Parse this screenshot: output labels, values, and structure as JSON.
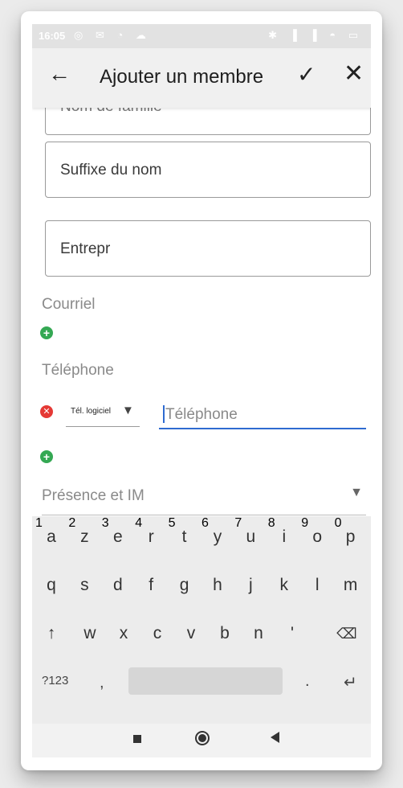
{
  "status": {
    "time": "16:05",
    "left_icons": "◎ ✉ ◔ ☁",
    "right_icons": "✱ ▐ ▐ ◓ ▭"
  },
  "appbar": {
    "back_icon": "←",
    "title": "Ajouter un membre",
    "check_icon": "✓",
    "close_icon": "✕"
  },
  "form": {
    "partial_field": "Nom de famille",
    "suffix_field": "Suffixe du nom",
    "company_field": "Entrepr",
    "email_label": "Courriel",
    "phone_label": "Téléphone",
    "phone_type": "Tél. logiciel",
    "phone_placeholder": "Téléphone",
    "presence_label": "Présence et IM"
  },
  "keyboard": {
    "row1": [
      {
        "k": "a",
        "h": "1"
      },
      {
        "k": "z",
        "h": "2"
      },
      {
        "k": "e",
        "h": "3"
      },
      {
        "k": "r",
        "h": "4"
      },
      {
        "k": "t",
        "h": "5"
      },
      {
        "k": "y",
        "h": "6"
      },
      {
        "k": "u",
        "h": "7"
      },
      {
        "k": "i",
        "h": "8"
      },
      {
        "k": "o",
        "h": "9"
      },
      {
        "k": "p",
        "h": "0"
      }
    ],
    "row2": [
      "q",
      "s",
      "d",
      "f",
      "g",
      "h",
      "j",
      "k",
      "l",
      "m"
    ],
    "row3": [
      "w",
      "x",
      "c",
      "v",
      "b",
      "n",
      "'"
    ],
    "shift": "↑",
    "backspace": "⌫",
    "symbols": "?123",
    "comma": ",",
    "period": ".",
    "enter": "↵"
  }
}
